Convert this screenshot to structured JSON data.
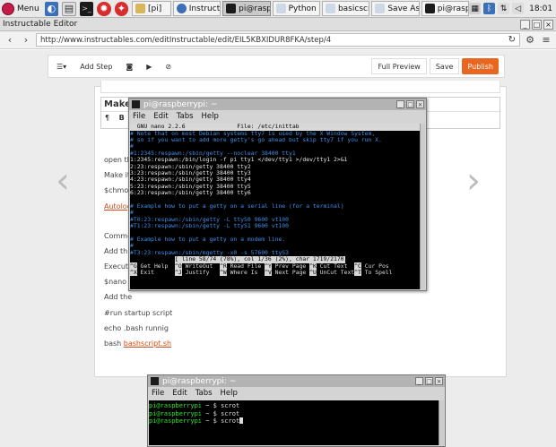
{
  "taskbar": {
    "menu_label": "Menu",
    "tasks": [
      {
        "label": "[pi]"
      },
      {
        "label": "Instruct..."
      },
      {
        "label": "pi@rasp..."
      },
      {
        "label": "Python ..."
      },
      {
        "label": "basicscr..."
      },
      {
        "label": "Save As"
      },
      {
        "label": "pi@rasp..."
      }
    ],
    "clock": "18:01"
  },
  "browser": {
    "window_title": "Instructable Editor",
    "url": "http://www.instructables.com/editInstructable/edit/EIL5KBXIDUR8FKA/step/4",
    "toolbar": {
      "add_step_label": "Add Step",
      "full_preview_label": "Full Preview",
      "save_label": "Save",
      "publish_label": "Publish"
    },
    "step_title": "Make",
    "paragraph_lines": [
      "open th",
      "Make it",
      "$chmod",
      "Autolog",
      "Comme",
      "Add th",
      "Execute",
      "$nano",
      "Add the",
      "#run startup script",
      "echo .bash runnig",
      "bash "
    ],
    "script_link": "bashscript.sh",
    "colors": {
      "publish": "#e8661f",
      "link": "#d14a17"
    }
  },
  "terminal_nano": {
    "title": "pi@raspberrypi: ~",
    "menu": [
      "File",
      "Edit",
      "Tabs",
      "Help"
    ],
    "nano_header": "  GNU nano 2.2.6               File: /etc/inittab",
    "lines": [
      {
        "text": "# Note that on most Debian systems tty7 is used by the X Window System,",
        "kind": "cmt"
      },
      {
        "text": "# so if you want to add more getty's go ahead but skip tty7 if you run X.",
        "kind": "cmt"
      },
      {
        "text": "#",
        "kind": "cmt"
      },
      {
        "text": "#1:2345:respawn:/sbin/getty --noclear 38400 tty1",
        "kind": "cmt"
      },
      {
        "text": "1:2345:respawn:/bin/login -f pi tty1 </dev/tty1 >/dev/tty1 2>&1",
        "kind": "cfg"
      },
      {
        "text": "2:23:respawn:/sbin/getty 38400 tty2",
        "kind": "cfg"
      },
      {
        "text": "3:23:respawn:/sbin/getty 38400 tty3",
        "kind": "cfg"
      },
      {
        "text": "4:23:respawn:/sbin/getty 38400 tty4",
        "kind": "cfg"
      },
      {
        "text": "5:23:respawn:/sbin/getty 38400 tty5",
        "kind": "cfg"
      },
      {
        "text": "6:23:respawn:/sbin/getty 38400 tty6",
        "kind": "cfg"
      },
      {
        "text": "",
        "kind": "cfg"
      },
      {
        "text": "# Example how to put a getty on a serial line (for a terminal)",
        "kind": "cmt"
      },
      {
        "text": "#",
        "kind": "cmt"
      },
      {
        "text": "#T0:23:respawn:/sbin/getty -L ttyS0 9600 vt100",
        "kind": "cmt"
      },
      {
        "text": "#T1:23:respawn:/sbin/getty -L ttyS1 9600 vt100",
        "kind": "cmt"
      },
      {
        "text": "",
        "kind": "cfg"
      },
      {
        "text": "# Example how to put a getty on a modem line.",
        "kind": "cmt"
      },
      {
        "text": "#",
        "kind": "cmt"
      },
      {
        "text": "#T3:23:respawn:/sbin/mgetty -x0 -s 57600 ttyS3",
        "kind": "cmt"
      }
    ],
    "status": "[ line 58/74 (78%), col 1/36 (2%), char 1719/2170 (79%) ]",
    "shortcuts_row1": [
      {
        "key": "^G",
        "label": "Get Help"
      },
      {
        "key": "^O",
        "label": "WriteOut"
      },
      {
        "key": "^R",
        "label": "Read File"
      },
      {
        "key": "^Y",
        "label": "Prev Page"
      },
      {
        "key": "^K",
        "label": "Cut Text"
      },
      {
        "key": "^C",
        "label": "Cur Pos"
      }
    ],
    "shortcuts_row2": [
      {
        "key": "^X",
        "label": "Exit"
      },
      {
        "key": "^J",
        "label": "Justify"
      },
      {
        "key": "^W",
        "label": "Where Is"
      },
      {
        "key": "^V",
        "label": "Next Page"
      },
      {
        "key": "^U",
        "label": "UnCut Text"
      },
      {
        "key": "^T",
        "label": "To Spell"
      }
    ]
  },
  "terminal_scrot": {
    "title": "pi@raspberrypi: ~",
    "menu": [
      "File",
      "Edit",
      "Tabs",
      "Help"
    ],
    "prompt": "pi@raspberrypi",
    "suffix": " ~ $ ",
    "commands": [
      "scrot",
      "scrot",
      "scrot"
    ]
  }
}
